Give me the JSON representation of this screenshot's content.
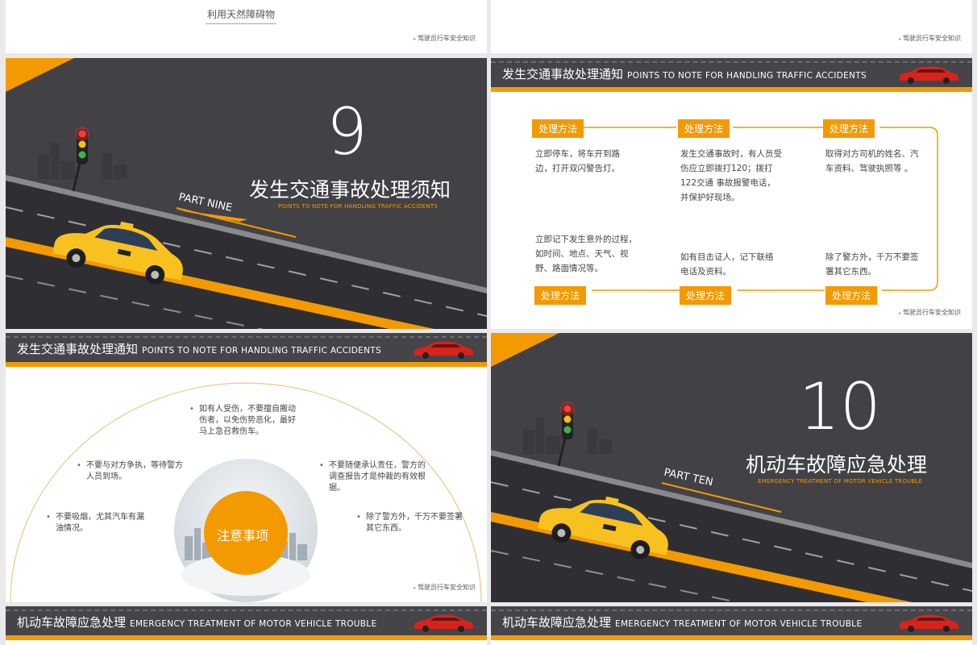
{
  "footer_text": "驾驶员行车安全知识",
  "slide_top_left": {
    "caption": "利用天然障碍物"
  },
  "slide_part9": {
    "number": "9",
    "title": "发生交通事故处理须知",
    "subtitle": "POINTS TO NOTE FOR HANDLING TRAFFIC ACCIDENTS",
    "part_label": "PART NINE"
  },
  "slide_notice": {
    "header_cn": "发生交通事故处理通知",
    "header_en": "POINTS TO NOTE FOR HANDLING TRAFFIC ACCIDENTS",
    "steps": [
      {
        "badge": "处理方法",
        "text": "立即停车，将车开到路边，打开双闪警告灯。"
      },
      {
        "badge": "处理方法",
        "text": "发生交通事故时，有人员受伤应立即拨打120；拨打122交通 事故报警电话，并保护好现场。"
      },
      {
        "badge": "处理方法",
        "text": "取得对方司机的姓名、汽车资料、驾驶执照等 。"
      },
      {
        "badge": "处理方法",
        "text": "立即记下发生意外的过程，如时间、地点、天气、视野、路面情况等。"
      },
      {
        "badge": "处理方法",
        "text": "如有目击证人，记下联络电话及资料。"
      },
      {
        "badge": "处理方法",
        "text": "除了警方外，千万不要签署其它东西。"
      }
    ]
  },
  "slide_attention": {
    "header_cn": "发生交通事故处理通知",
    "header_en": "POINTS TO NOTE FOR HANDLING TRAFFIC ACCIDENTS",
    "center": "注意事项",
    "notes": [
      "如有人受伤，不要擅自搬动伤者，以免伤势恶化，最好马上急召救伤车。",
      "不要与对方争执，等待警方人员到场。",
      "不要随便承认责任，警方的调查报告才是仲裁的有效根据。",
      "不要吸烟，尤其汽车有漏油情况。",
      "除了警方外，千万不要签署其它东西。"
    ]
  },
  "slide_part10": {
    "number": "10",
    "title": "机动车故障应急处理",
    "subtitle": "EMERGENCY TREATMENT OF MOTOR VEHICLE TROUBLE",
    "part_label": "PART TEN"
  },
  "slide_bottom": {
    "header_cn": "机动车故障应急处理",
    "header_en": "EMERGENCY TREATMENT OF MOTOR VEHICLE TROUBLE"
  },
  "colors": {
    "accent": "#f39a00",
    "dark": "#424146",
    "taxi": "#f7c21f",
    "car_red": "#d9231a"
  }
}
